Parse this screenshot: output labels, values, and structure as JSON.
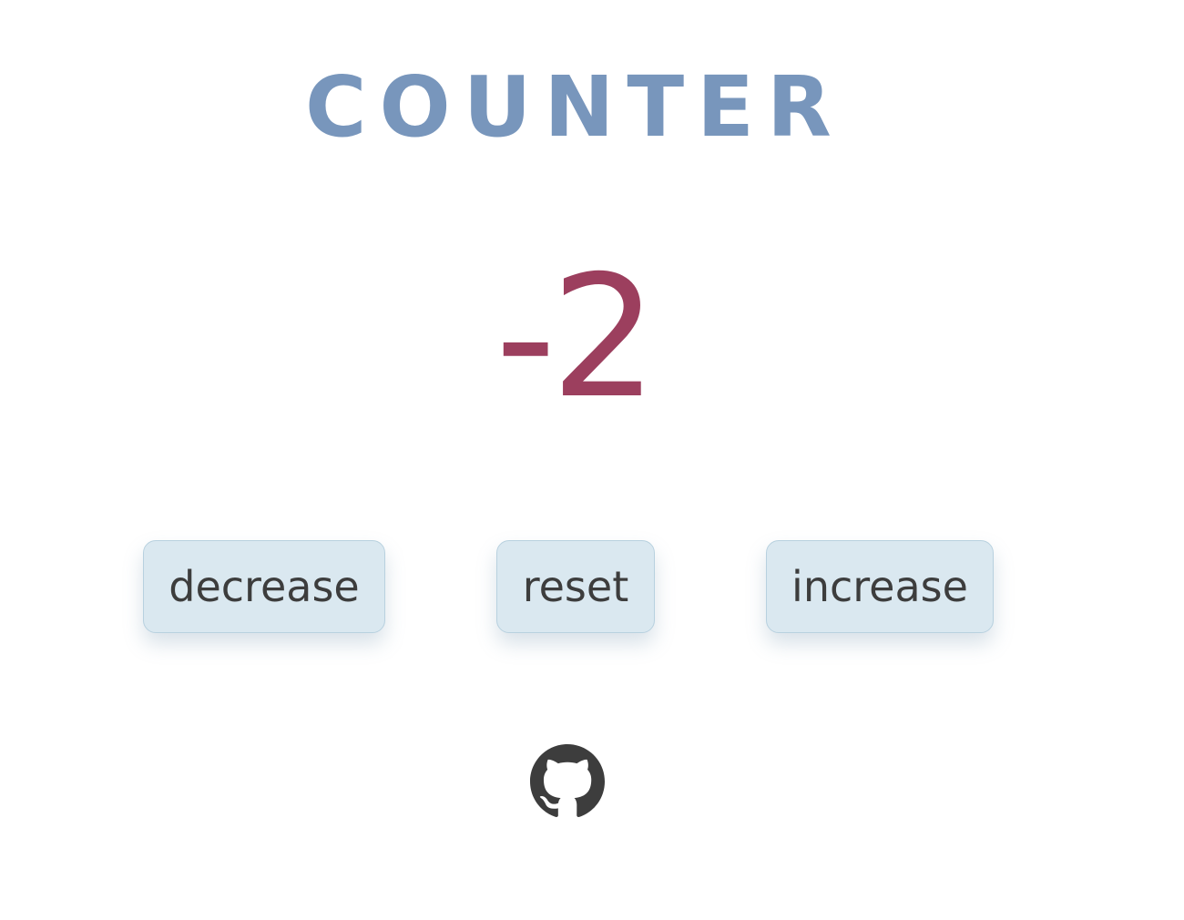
{
  "header": {
    "title": "COUNTER"
  },
  "counter": {
    "value": "-2"
  },
  "controls": {
    "decrease_label": "decrease",
    "reset_label": "reset",
    "increase_label": "increase"
  },
  "footer": {
    "link_icon": "github-icon"
  },
  "colors": {
    "title": "#7896bc",
    "count_negative": "#9c3f5e",
    "button_bg": "#dae8f0",
    "button_border": "#b8d1df",
    "button_text": "#3d3d3d",
    "icon": "#3d3d3d"
  }
}
